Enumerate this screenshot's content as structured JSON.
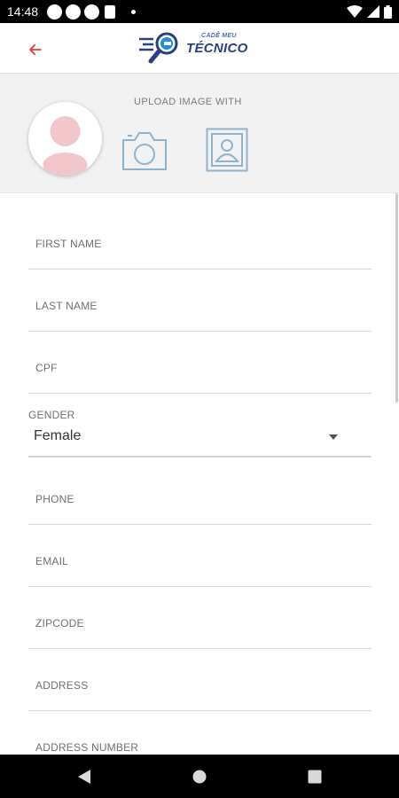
{
  "status_bar": {
    "time": "14:48"
  },
  "app_bar": {
    "logo_top_text": "CADÊ MEU",
    "logo_main_text": "TÉCNICO",
    "back_icon": "arrow-left-icon",
    "accent_color": "#e53935"
  },
  "upload": {
    "label": "UPLOAD IMAGE WITH",
    "camera_icon": "camera-icon",
    "gallery_icon": "gallery-portrait-icon",
    "icon_color": "#8fb2cf"
  },
  "form": {
    "first_name_label": "FIRST NAME",
    "last_name_label": "LAST NAME",
    "cpf_label": "CPF",
    "gender_label": "GENDER",
    "gender_value": "Female",
    "phone_label": "PHONE",
    "email_label": "EMAIL",
    "zipcode_label": "ZIPCODE",
    "address_label": "ADDRESS",
    "address_number_label": "ADDRESS NUMBER"
  },
  "nav_bar": {
    "back_icon": "nav-back-icon",
    "home_icon": "nav-home-icon",
    "recents_icon": "nav-recents-icon"
  }
}
